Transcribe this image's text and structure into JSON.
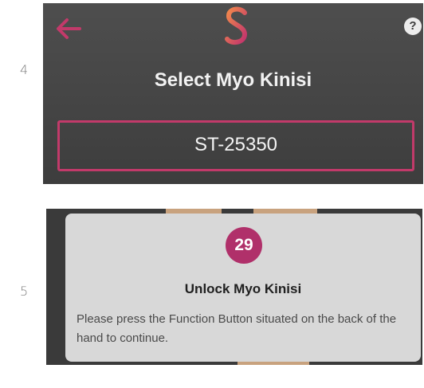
{
  "steps": [
    {
      "number": "4",
      "header": {
        "back_icon": "arrow-left-icon",
        "logo_icon": "s-logo-icon",
        "help_symbol": "?"
      },
      "title": "Select Myo Kinisi",
      "device_id": "ST-25350",
      "colors": {
        "accent": "#c23a6a",
        "background": "#454545"
      }
    },
    {
      "number": "5",
      "badge": "29",
      "title": "Unlock Myo Kinisi",
      "message": "Please press the Function Button situated on the back of the hand to continue.",
      "colors": {
        "badge": "#b0306a",
        "dialog": "#d8d8d8"
      }
    }
  ]
}
